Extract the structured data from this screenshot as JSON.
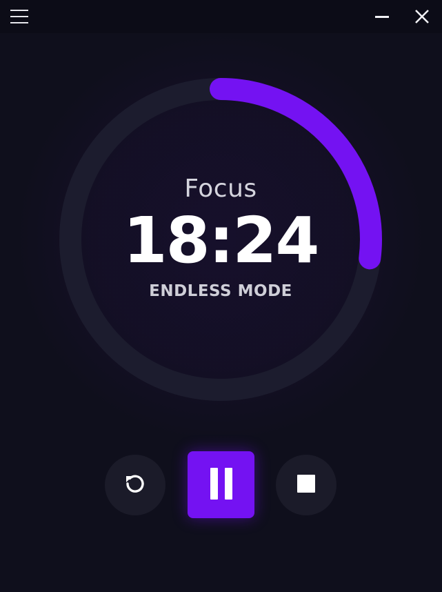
{
  "window": {
    "menu_icon": "hamburger-menu-icon",
    "minimize_icon": "minimize-icon",
    "close_icon": "close-icon"
  },
  "timer": {
    "mode": "Focus",
    "time": "18:24",
    "sub_label": "ENDLESS MODE",
    "progress_fraction": 0.27
  },
  "controls": {
    "reset_icon": "reset-icon",
    "pause_icon": "pause-icon",
    "stop_icon": "stop-icon"
  },
  "colors": {
    "background": "#0f0f1c",
    "titlebar": "#0c0c17",
    "accent": "#7412f2",
    "ring_track": "#1c1c2e",
    "button_bg": "#1b1b29"
  }
}
